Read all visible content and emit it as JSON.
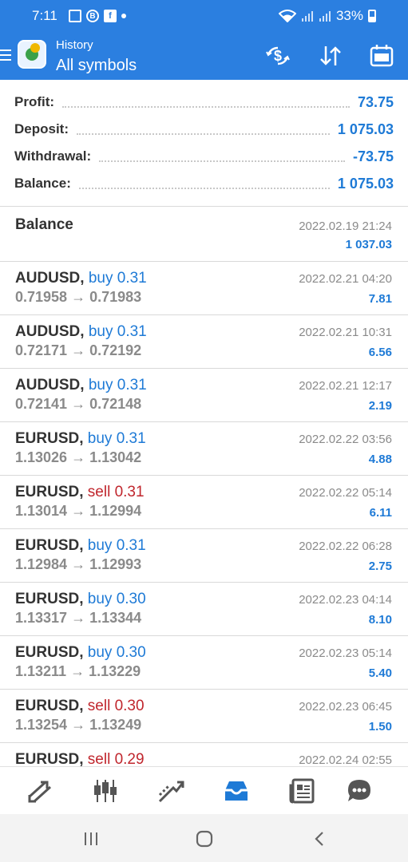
{
  "status_bar": {
    "time": "7:11",
    "battery": "33%",
    "icons": [
      "image-icon",
      "b-circle-icon",
      "facebook-icon",
      "dot-icon",
      "wifi-icon",
      "signal-icon",
      "signal-icon",
      "battery-icon"
    ]
  },
  "app_bar": {
    "subtitle": "History",
    "title": "All symbols",
    "actions": [
      "currency-exchange-icon",
      "sort-icon",
      "calendar-icon"
    ],
    "accent_color": "#2b7fe0"
  },
  "summary": {
    "profit_label": "Profit:",
    "profit_value": "73.75",
    "deposit_label": "Deposit:",
    "deposit_value": "1 075.03",
    "withdrawal_label": "Withdrawal:",
    "withdrawal_value": "-73.75",
    "balance_label": "Balance:",
    "balance_value": "1 075.03"
  },
  "balance_entry": {
    "title": "Balance",
    "datetime": "2022.02.19 21:24",
    "amount": "1 037.03"
  },
  "trades": [
    {
      "symbol": "AUDUSD,",
      "side": "buy 0.31",
      "type": "buy",
      "prices": "0.71958 → 0.71983",
      "datetime": "2022.02.21 04:20",
      "profit": "7.81"
    },
    {
      "symbol": "AUDUSD,",
      "side": "buy 0.31",
      "type": "buy",
      "prices": "0.72171 → 0.72192",
      "datetime": "2022.02.21 10:31",
      "profit": "6.56"
    },
    {
      "symbol": "AUDUSD,",
      "side": "buy 0.31",
      "type": "buy",
      "prices": "0.72141 → 0.72148",
      "datetime": "2022.02.21 12:17",
      "profit": "2.19"
    },
    {
      "symbol": "EURUSD,",
      "side": "buy 0.31",
      "type": "buy",
      "prices": "1.13026 → 1.13042",
      "datetime": "2022.02.22 03:56",
      "profit": "4.88"
    },
    {
      "symbol": "EURUSD,",
      "side": "sell 0.31",
      "type": "sell",
      "prices": "1.13014 → 1.12994",
      "datetime": "2022.02.22 05:14",
      "profit": "6.11"
    },
    {
      "symbol": "EURUSD,",
      "side": "buy 0.31",
      "type": "buy",
      "prices": "1.12984 → 1.12993",
      "datetime": "2022.02.22 06:28",
      "profit": "2.75"
    },
    {
      "symbol": "EURUSD,",
      "side": "buy 0.30",
      "type": "buy",
      "prices": "1.13317 → 1.13344",
      "datetime": "2022.02.23 04:14",
      "profit": "8.10"
    },
    {
      "symbol": "EURUSD,",
      "side": "buy 0.30",
      "type": "buy",
      "prices": "1.13211 → 1.13229",
      "datetime": "2022.02.23 05:14",
      "profit": "5.40"
    },
    {
      "symbol": "EURUSD,",
      "side": "sell 0.30",
      "type": "sell",
      "prices": "1.13254 → 1.13249",
      "datetime": "2022.02.23 06:45",
      "profit": "1.50"
    },
    {
      "symbol": "EURUSD,",
      "side": "sell 0.29",
      "type": "sell",
      "prices": "",
      "datetime": "2022.02.24 02:55",
      "profit": ""
    }
  ],
  "bottom_nav": [
    "quotes-icon",
    "chart-icon",
    "trade-icon",
    "history-icon",
    "news-icon",
    "chat-icon"
  ],
  "system_nav": [
    "recents-icon",
    "home-icon",
    "back-icon"
  ]
}
